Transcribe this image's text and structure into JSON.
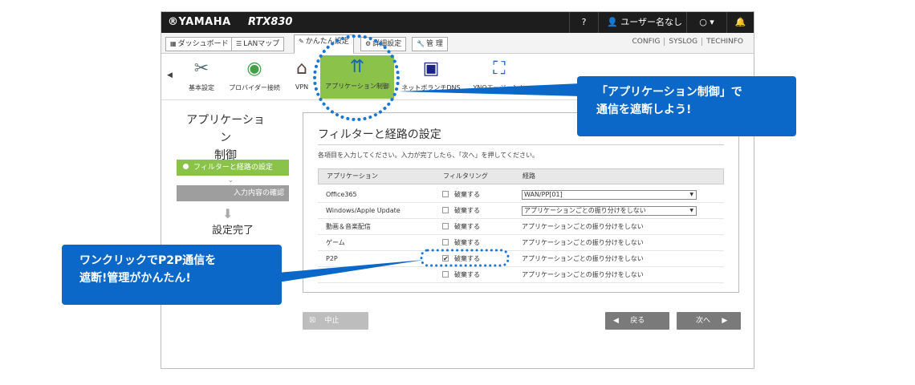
{
  "header": {
    "brand": "®YAMAHA",
    "model": "RTX830",
    "help": "?",
    "user": "ユーザー名なし",
    "monitor": "○ ▾",
    "bell": "🔔"
  },
  "tabs": [
    {
      "icon": "▦",
      "label": "ダッシュボード"
    },
    {
      "icon": "☰",
      "label": "LANマップ"
    },
    {
      "icon": "✎",
      "label": "かんたん設定"
    },
    {
      "icon": "⚙",
      "label": "詳細設定"
    },
    {
      "icon": "🔧",
      "label": "管 理"
    }
  ],
  "toplinks": [
    "CONFIG",
    "SYSLOG",
    "TECHINFO"
  ],
  "wizard_icons": [
    {
      "name": "basic-settings-icon",
      "label": "基本設定",
      "glyph": "✂"
    },
    {
      "name": "provider-icon",
      "label": "プロバイダー接続",
      "glyph": "◉"
    },
    {
      "name": "vpn-icon",
      "label": "VPN",
      "glyph": "⌂"
    },
    {
      "name": "app-control-icon",
      "label": "アプリケーション制御",
      "glyph": "⇈"
    },
    {
      "name": "netvolante-icon",
      "label": "ネットボランチDNS",
      "glyph": "▣"
    },
    {
      "name": "yno-icon",
      "label": "YNOエージェント",
      "glyph": "⛶"
    }
  ],
  "sidebar": {
    "title_line1": "アプリケーション",
    "title_line2": "制御",
    "step1": "フィルターと経路の設定",
    "step2": "入力内容の確認",
    "step3": "設定完了"
  },
  "panel": {
    "title": "フィルターと経路の設定",
    "instruction": "各項目を入力してください。入力が完了したら、「次へ」を押してください。",
    "columns": [
      "アプリケーション",
      "フィルタリング",
      "経路"
    ],
    "rows": [
      {
        "app": "Office365",
        "filter": "破棄する",
        "checked": false,
        "route": "WAN/PP[01]",
        "select": true
      },
      {
        "app": "Windows/Apple Update",
        "filter": "破棄する",
        "checked": false,
        "route": "アプリケーションごとの振り分けをしない",
        "select": true
      },
      {
        "app": "動画＆音楽配信",
        "filter": "破棄する",
        "checked": false,
        "route": "アプリケーションごとの振り分けをしない",
        "select": false
      },
      {
        "app": "ゲーム",
        "filter": "破棄する",
        "checked": false,
        "route": "アプリケーションごとの振り分けをしない",
        "select": false
      },
      {
        "app": "P2P",
        "filter": "破棄する",
        "checked": true,
        "route": "アプリケーションごとの振り分けをしない",
        "select": false
      },
      {
        "app": "",
        "filter": "破棄する",
        "checked": false,
        "route": "アプリケーションごとの振り分けをしない",
        "select": false
      }
    ]
  },
  "buttons": {
    "cancel": "中止",
    "back": "戻る",
    "next": "次へ"
  },
  "callouts": {
    "top_line1": "「アプリケーション制御」で",
    "top_line2": "通信を遮断しよう!",
    "bottom_line1": "ワンクリックでP2P通信を",
    "bottom_line2": "遮断!管理がかんたん!"
  },
  "colors": {
    "accent_green": "#8bc34a",
    "callout_blue": "#0b68c8",
    "highlight_dots": "#1976d2",
    "header_dark": "#1d1d1d"
  }
}
